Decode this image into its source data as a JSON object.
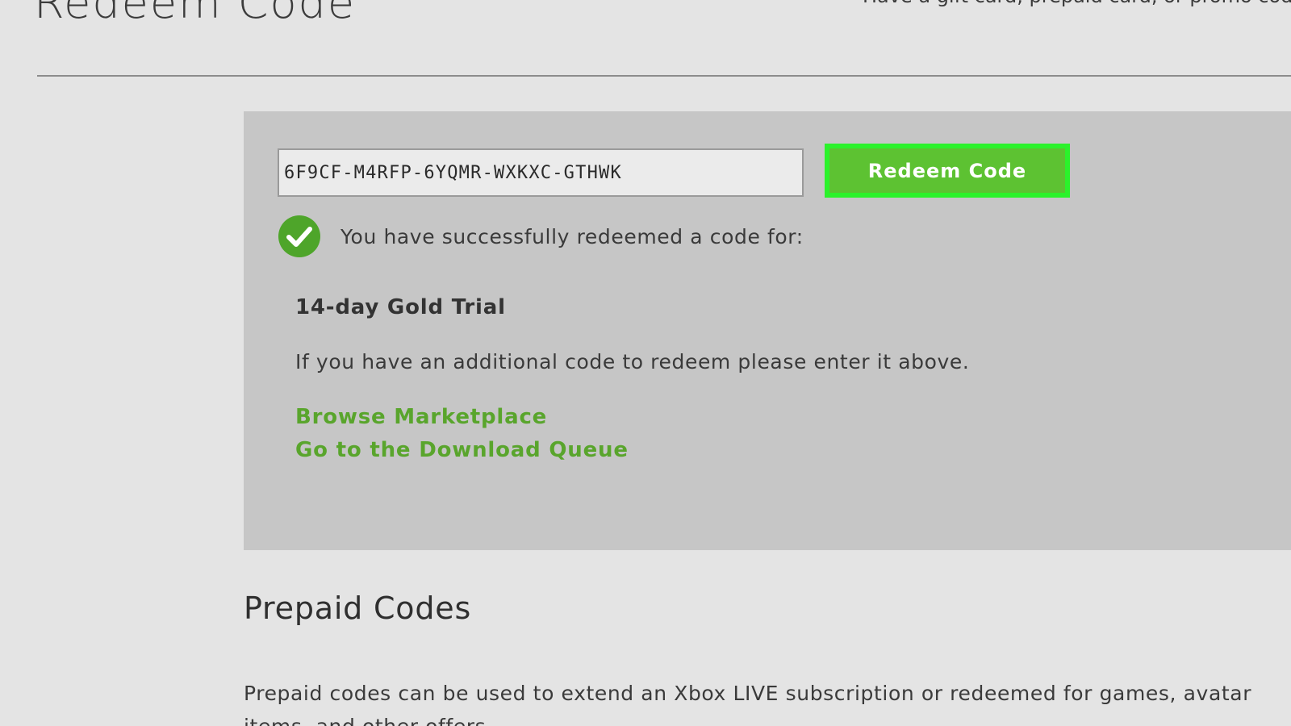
{
  "page": {
    "title": "Redeem Code",
    "intro": "Have a gift card, prepaid card, or promo code? Redeem it here."
  },
  "redeem": {
    "code_value": "6F9CF-M4RFP-6YQMR-WXKXC-GTHWK",
    "button_label": "Redeem Code",
    "button_color": "#5dc232",
    "highlight_color": "#2bf22b"
  },
  "result": {
    "status_icon": "check-circle-icon",
    "success_message": "You have successfully redeemed a code for:",
    "product": "14-day Gold Trial",
    "additional_message": "If you have an additional code to redeem please enter it above.",
    "links": [
      {
        "label": "Browse Marketplace"
      },
      {
        "label": "Go to the Download Queue"
      }
    ],
    "link_color": "#59a52c"
  },
  "prepaid": {
    "heading": "Prepaid Codes",
    "description": "Prepaid codes can be used to extend an Xbox LIVE subscription or redeemed for games, avatar items, and other offers."
  }
}
